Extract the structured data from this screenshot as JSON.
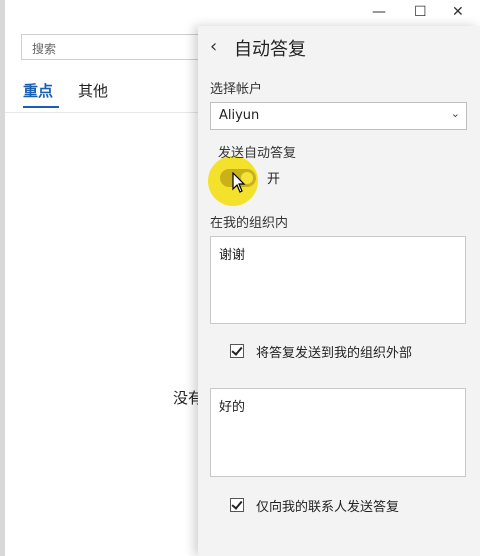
{
  "window": {
    "minimize": "—",
    "maximize": "☐",
    "close": "✕"
  },
  "mail": {
    "search_placeholder": "搜索",
    "tabs": [
      {
        "label": "重点"
      },
      {
        "label": "其他"
      }
    ],
    "empty_text": "没有"
  },
  "panel": {
    "back_icon": "‹",
    "title": "自动答复",
    "select_account_label": "选择帐户",
    "account_value": "Aliyun",
    "send_auto_reply_label": "发送自动答复",
    "toggle_state_label": "开",
    "toggle_on": true,
    "inside_org_label": "在我的组织内",
    "inside_org_message": "谢谢",
    "send_outside_checkbox_label": "将答复发送到我的组织外部",
    "send_outside_checked": true,
    "outside_message": "好的",
    "contacts_only_checkbox_label": "仅向我的联系人发送答复",
    "contacts_only_checked": true
  },
  "colors": {
    "accent": "#1a5fb4",
    "cursor_highlight": "#f4df1a",
    "panel_bg": "#f3f3f3"
  }
}
